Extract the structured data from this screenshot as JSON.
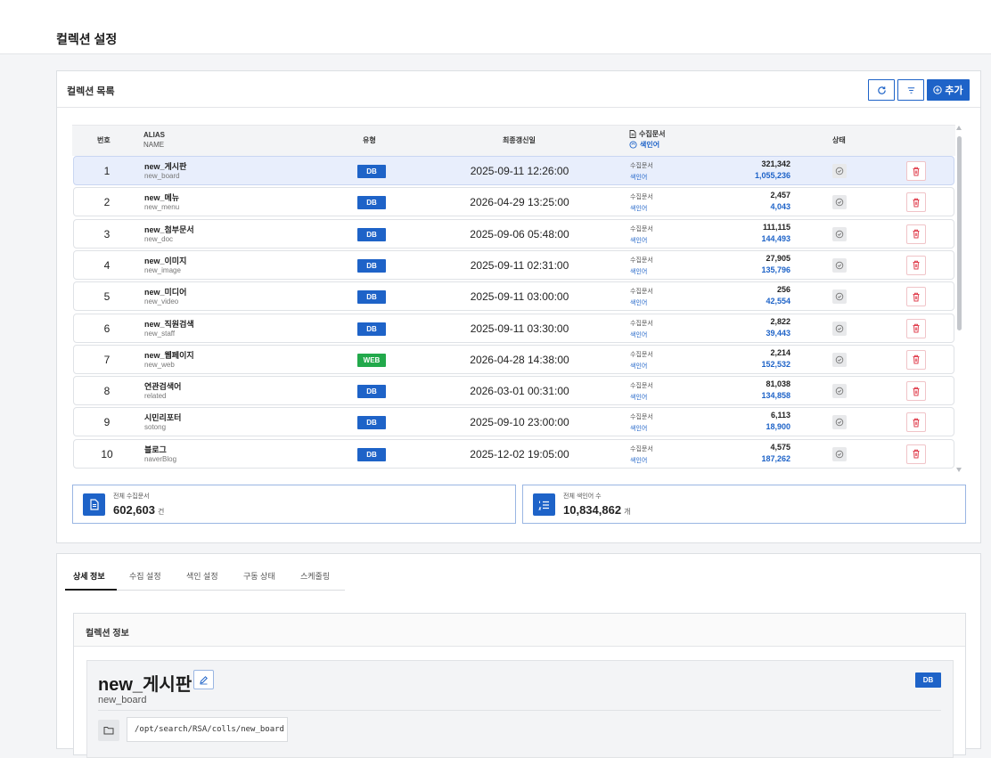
{
  "page": {
    "title": "컬렉션 설정"
  },
  "collections_panel": {
    "title": "컬렉션 목록",
    "refresh_icon": "refresh-icon",
    "sort_icon": "sort-icon",
    "add_label": "추가",
    "columns": {
      "num": "번호",
      "alias": "ALIAS",
      "name": "NAME",
      "type": "유형",
      "updated": "최종갱신일",
      "docs": "수집문서",
      "index": "색인어",
      "status": "상태"
    },
    "rows": [
      {
        "num": "1",
        "alias": "new_게시판",
        "name": "new_board",
        "type": "DB",
        "date": "2025-09-11 12:26:00",
        "docs_label": "수집문서",
        "index_label": "색인어",
        "docs": "321,342",
        "index": "1,055,236",
        "selected": true
      },
      {
        "num": "2",
        "alias": "new_메뉴",
        "name": "new_menu",
        "type": "DB",
        "date": "2026-04-29 13:25:00",
        "docs_label": "수집문서",
        "index_label": "색인어",
        "docs": "2,457",
        "index": "4,043"
      },
      {
        "num": "3",
        "alias": "new_첨부문서",
        "name": "new_doc",
        "type": "DB",
        "date": "2025-09-06 05:48:00",
        "docs_label": "수집문서",
        "index_label": "색인어",
        "docs": "111,115",
        "index": "144,493"
      },
      {
        "num": "4",
        "alias": "new_이미지",
        "name": "new_image",
        "type": "DB",
        "date": "2025-09-11 02:31:00",
        "docs_label": "수집문서",
        "index_label": "색인어",
        "docs": "27,905",
        "index": "135,796"
      },
      {
        "num": "5",
        "alias": "new_미디어",
        "name": "new_video",
        "type": "DB",
        "date": "2025-09-11 03:00:00",
        "docs_label": "수집문서",
        "index_label": "색인어",
        "docs": "256",
        "index": "42,554"
      },
      {
        "num": "6",
        "alias": "new_직원검색",
        "name": "new_staff",
        "type": "DB",
        "date": "2025-09-11 03:30:00",
        "docs_label": "수집문서",
        "index_label": "색인어",
        "docs": "2,822",
        "index": "39,443"
      },
      {
        "num": "7",
        "alias": "new_웹페이지",
        "name": "new_web",
        "type": "WEB",
        "date": "2026-04-28 14:38:00",
        "docs_label": "수집문서",
        "index_label": "색인어",
        "docs": "2,214",
        "index": "152,532"
      },
      {
        "num": "8",
        "alias": "연관검색어",
        "name": "related",
        "type": "DB",
        "date": "2026-03-01 00:31:00",
        "docs_label": "수집문서",
        "index_label": "색인어",
        "docs": "81,038",
        "index": "134,858"
      },
      {
        "num": "9",
        "alias": "시민리포터",
        "name": "sotong",
        "type": "DB",
        "date": "2025-09-10 23:00:00",
        "docs_label": "수집문서",
        "index_label": "색인어",
        "docs": "6,113",
        "index": "18,900"
      },
      {
        "num": "10",
        "alias": "블로그",
        "name": "naverBlog",
        "type": "DB",
        "date": "2025-12-02 19:05:00",
        "docs_label": "수집문서",
        "index_label": "색인어",
        "docs": "4,575",
        "index": "187,262"
      }
    ],
    "totals": {
      "docs_label": "전체 수집문서",
      "docs_value": "602,603",
      "docs_unit": "건",
      "index_label": "전체 색인어 수",
      "index_value": "10,834,862",
      "index_unit": "개"
    }
  },
  "detail": {
    "tabs": [
      "상세 정보",
      "수집 설정",
      "색인 설정",
      "구동 상태",
      "스케줄링"
    ],
    "info_title": "컬렉션 정보",
    "alias": "new_게시판",
    "name": "new_board",
    "type": "DB",
    "path": "/opt/search/RSA/colls/new_board"
  },
  "colors": {
    "primary": "#1e63c8",
    "web": "#22a94b",
    "danger": "#e0404f"
  }
}
